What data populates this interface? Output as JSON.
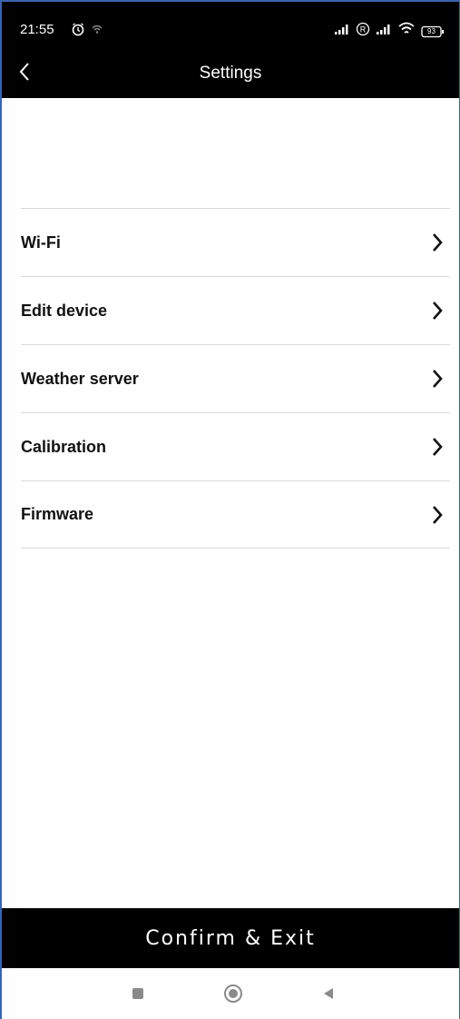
{
  "status_bar": {
    "time": "21:55",
    "battery_level": "93",
    "icons": [
      "alarm-icon",
      "notification-icon",
      "signal-icon",
      "roaming-icon",
      "signal-icon",
      "wifi-icon",
      "battery-icon"
    ]
  },
  "header": {
    "title": "Settings",
    "back_icon": "back-chevron-icon"
  },
  "menu": {
    "items": [
      {
        "label": "Wi-Fi"
      },
      {
        "label": "Edit device"
      },
      {
        "label": "Weather server"
      },
      {
        "label": "Calibration"
      },
      {
        "label": "Firmware"
      }
    ]
  },
  "footer": {
    "confirm_label": "Confirm & Exit"
  },
  "navigation_bar": {
    "buttons": [
      "recents-square-icon",
      "home-circle-icon",
      "back-triangle-icon"
    ]
  },
  "colors": {
    "header_bg": "#000000",
    "header_text": "#ffffff",
    "divider": "#d9d9d9",
    "confirm_bg": "#000000",
    "confirm_text": "#ffffff"
  }
}
